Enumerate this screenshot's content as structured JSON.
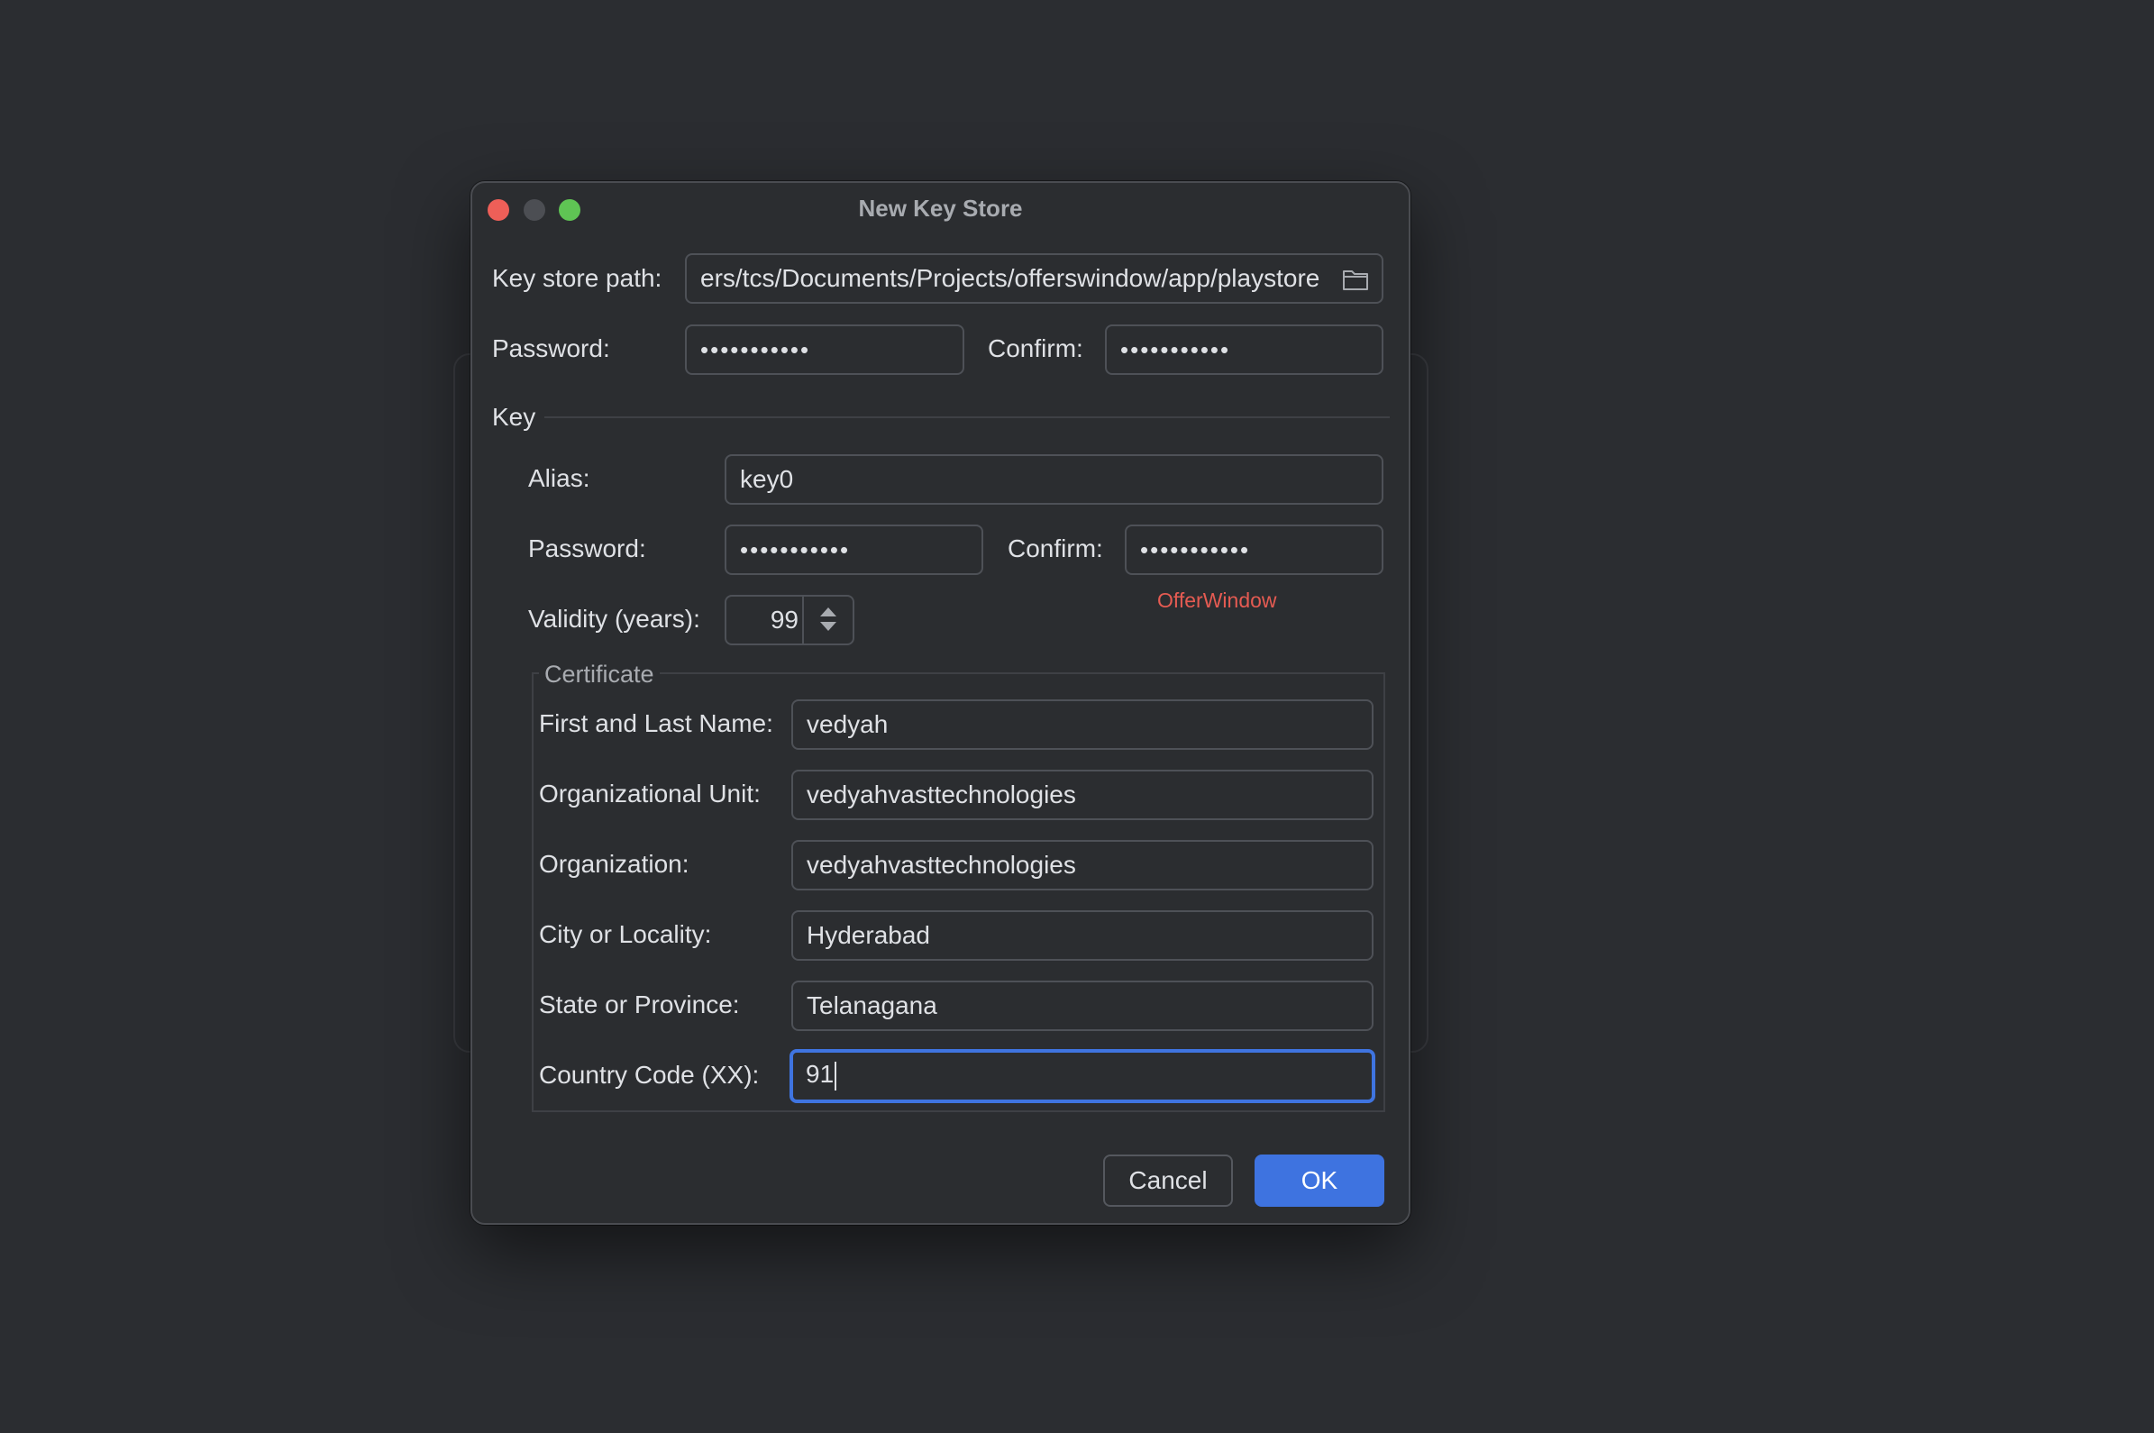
{
  "dialog": {
    "title": "New Key Store"
  },
  "keystore": {
    "path_label": "Key store path:",
    "path_value": "ers/tcs/Documents/Projects/offerswindow/app/playstore",
    "password_label": "Password:",
    "password_value": "•••••••••••",
    "confirm_label": "Confirm:",
    "confirm_value": "•••••••••••"
  },
  "key": {
    "section_label": "Key",
    "alias_label": "Alias:",
    "alias_value": "key0",
    "password_label": "Password:",
    "password_value": "•••••••••••",
    "confirm_label": "Confirm:",
    "confirm_value": "•••••••••••",
    "validity_label": "Validity (years):",
    "validity_value": "99",
    "error_text": "OfferWindow"
  },
  "certificate": {
    "section_label": "Certificate",
    "name_label": "First and Last Name:",
    "name_value": "vedyah",
    "unit_label": "Organizational Unit:",
    "unit_value": "vedyahvasttechnologies",
    "org_label": "Organization:",
    "org_value": "vedyahvasttechnologies",
    "city_label": "City or Locality:",
    "city_value": "Hyderabad",
    "state_label": "State or Province:",
    "state_value": "Telanagana",
    "country_label": "Country Code (XX):",
    "country_value": "91"
  },
  "buttons": {
    "cancel_label": "Cancel",
    "ok_label": "OK"
  },
  "icons": {
    "browse": "folder-icon",
    "spinner_up": "chevron-up-icon",
    "spinner_down": "chevron-down-icon"
  },
  "colors": {
    "accent": "#3e73e0",
    "error": "#e55b52",
    "close": "#ee5f58",
    "maximize": "#5fc454"
  }
}
